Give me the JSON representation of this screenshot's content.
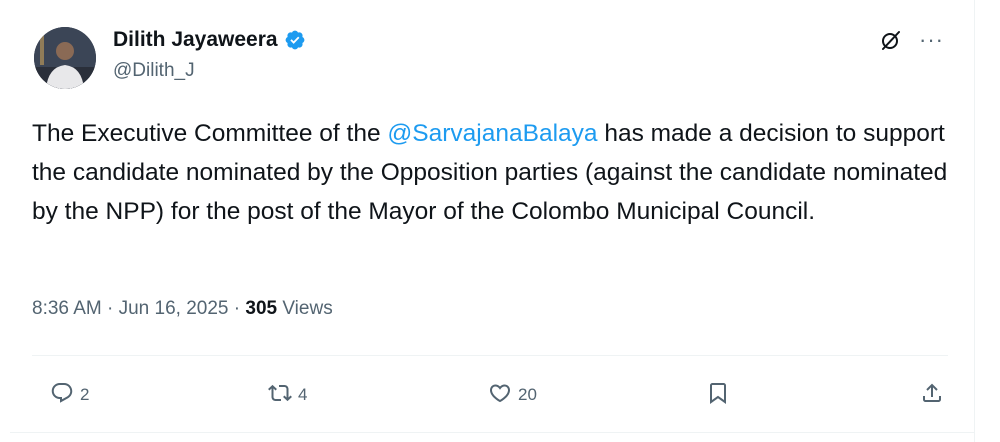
{
  "author": {
    "display_name": "Dilith Jayaweera",
    "handle": "@Dilith_J",
    "verified": true,
    "verified_color": "#1d9bf0"
  },
  "header_icons": {
    "grok": "grok-icon",
    "more": "···"
  },
  "post": {
    "text_before": "The Executive Committee of the ",
    "mention": "@SarvajanaBalaya",
    "text_after": " has made a decision to  support the candidate nominated by the Opposition parties (against the candidate nominated by the NPP) for the post of the Mayor of the Colombo Municipal Council."
  },
  "meta": {
    "time": "8:36 AM",
    "separator_1": " · ",
    "date": "Jun 16, 2025",
    "separator_2": " · ",
    "views_count": "305",
    "views_label": " Views"
  },
  "actions": {
    "reply_count": "2",
    "repost_count": "4",
    "like_count": "20"
  },
  "colors": {
    "text": "#0f1419",
    "secondary": "#536471",
    "link": "#1d9bf0",
    "border": "#eff3f4"
  }
}
